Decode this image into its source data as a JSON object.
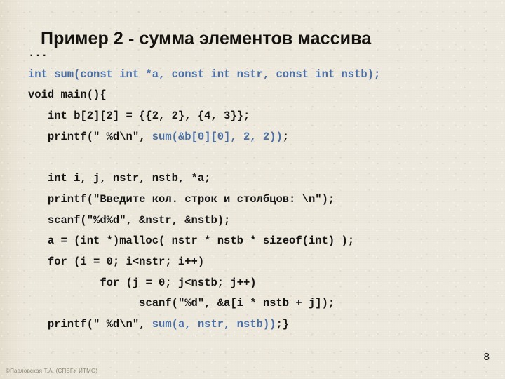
{
  "slide": {
    "title": "Пример 2 - сумма элементов массива",
    "page_number": "8",
    "credit": "©Павловская Т.А. (СПБГУ ИТМО)",
    "background_color": "#ece7db",
    "title_color": "#14120f",
    "code_color": "#151515",
    "code_accent_color": "#4a6fa5"
  },
  "code": {
    "lines": [
      {
        "indent": "",
        "segments": [
          {
            "text": "...",
            "color": "black"
          }
        ]
      },
      {
        "indent": "",
        "segments": [
          {
            "text": "int sum(const int *a, const int nstr, const int nstb);",
            "color": "blue"
          }
        ]
      },
      {
        "indent": "",
        "segments": [
          {
            "text": "void main(){",
            "color": "black"
          }
        ]
      },
      {
        "indent": "   ",
        "segments": [
          {
            "text": "int b[2][2] = {{2, 2}, {4, 3}};",
            "color": "black"
          }
        ]
      },
      {
        "indent": "   ",
        "segments": [
          {
            "text": "printf(\" %d\\n\", ",
            "color": "black"
          },
          {
            "text": "sum(&b[0][0], 2, 2))",
            "color": "blue"
          },
          {
            "text": ";",
            "color": "black"
          }
        ]
      },
      {
        "indent": "",
        "segments": []
      },
      {
        "indent": "   ",
        "segments": [
          {
            "text": "int i, j, nstr, nstb, *a;",
            "color": "black"
          }
        ]
      },
      {
        "indent": "   ",
        "segments": [
          {
            "text": "printf(\"Введите кол. строк и столбцов: \\n\");",
            "color": "black"
          }
        ]
      },
      {
        "indent": "   ",
        "segments": [
          {
            "text": "scanf(\"%d%d\", &nstr, &nstb);",
            "color": "black"
          }
        ]
      },
      {
        "indent": "   ",
        "segments": [
          {
            "text": "a = (int *)malloc( nstr * nstb * sizeof(int) );",
            "color": "black"
          }
        ]
      },
      {
        "indent": "   ",
        "segments": [
          {
            "text": "for (i = 0; i<nstr; i++)",
            "color": "black"
          }
        ]
      },
      {
        "indent": "           ",
        "segments": [
          {
            "text": "for (j = 0; j<nstb; j++)",
            "color": "black"
          }
        ]
      },
      {
        "indent": "                 ",
        "segments": [
          {
            "text": "scanf(\"%d\", &a[i * nstb + j]);",
            "color": "black"
          }
        ]
      },
      {
        "indent": "   ",
        "segments": [
          {
            "text": "printf(\" %d\\n\", ",
            "color": "black"
          },
          {
            "text": "sum(a, nstr, nstb))",
            "color": "blue"
          },
          {
            "text": ";}",
            "color": "black"
          }
        ]
      }
    ]
  }
}
